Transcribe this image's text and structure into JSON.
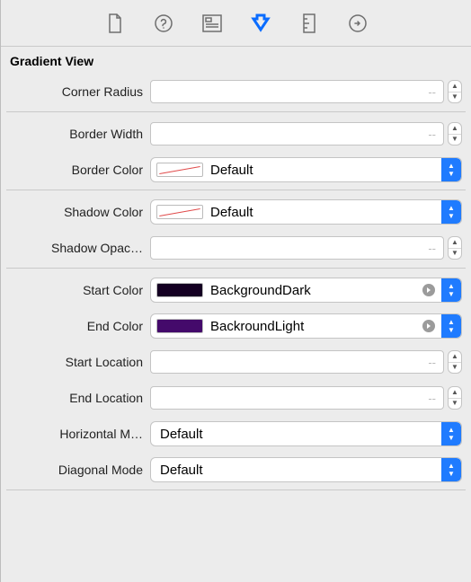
{
  "section": {
    "title": "Gradient View"
  },
  "placeholders": {
    "numeric": "--"
  },
  "labels": {
    "cornerRadius": "Corner Radius",
    "borderWidth": "Border Width",
    "borderColor": "Border Color",
    "shadowColor": "Shadow Color",
    "shadowOpacity": "Shadow Opac…",
    "startColor": "Start Color",
    "endColor": "End Color",
    "startLocation": "Start Location",
    "endLocation": "End Location",
    "horizontalMode": "Horizontal M…",
    "diagonalMode": "Diagonal Mode"
  },
  "values": {
    "borderColor": {
      "name": "Default",
      "swatch": "none"
    },
    "shadowColor": {
      "name": "Default",
      "swatch": "none"
    },
    "startColor": {
      "name": "BackgroundDark",
      "swatch": "#140022"
    },
    "endColor": {
      "name": "BackroundLight",
      "swatch": "#440a6b"
    },
    "horizontalMode": "Default",
    "diagonalMode": "Default"
  }
}
